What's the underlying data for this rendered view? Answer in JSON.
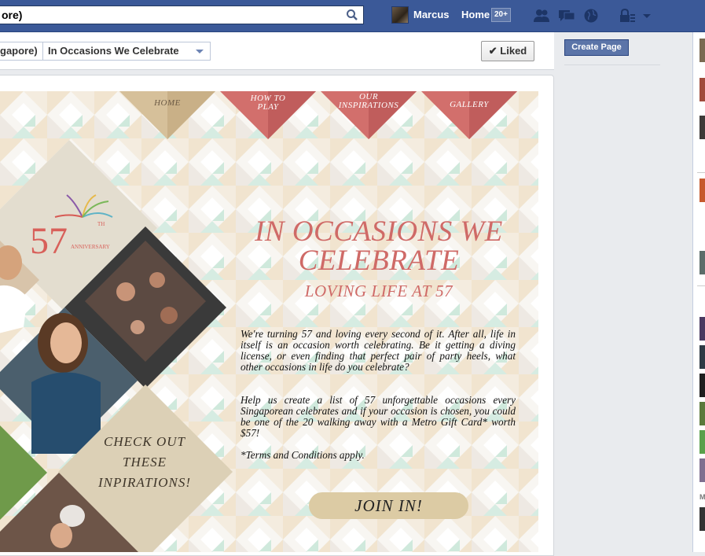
{
  "topbar": {
    "search_value": "ore)",
    "user_name": "Marcus",
    "home_label": "Home",
    "home_badge": "20+",
    "icons": [
      "search-icon",
      "friend-requests-icon",
      "messages-icon",
      "notifications-globe-icon",
      "privacy-lock-icon",
      "account-menu-chevron-icon"
    ]
  },
  "header": {
    "crumb_prev": "gapore)",
    "crumb_page": "In Occasions We Celebrate",
    "liked_label": "Liked"
  },
  "app": {
    "nav": [
      "HOME",
      "HOW TO PLAY",
      "OUR INSPIRATIONS",
      "GALLERY"
    ],
    "badge_number": "57",
    "badge_super": "TH",
    "badge_word": "ANNIVERSARY",
    "title": "IN OCCASIONS WE CELEBRATE",
    "subtitle": "LOVING LIFE AT 57",
    "para1": "We're turning 57 and loving every second of it. After all, life in itself is an occasion worth celebrating. Be it getting a diving license, or even finding that perfect pair of party heels, what other occasions in life do you celebrate?",
    "para2": "Help us create a list of 57 unforgettable occasions every Singaporean celebrates and if your occasion is chosen, you could be one of the 20 walking away with a Metro Gift Card* worth $57!",
    "para3": "*Terms and Conditions apply.",
    "join_label": "JOIN IN!",
    "checkout": "CHECK OUT THESE INPIRATIONS!"
  },
  "sidebar": {
    "create_page_label": "Create Page"
  },
  "chat": {
    "section_letter": "M"
  },
  "colors": {
    "facebook_blue": "#3b5998",
    "accent_red": "#cf6a67",
    "nav_tan": "#d6c09a",
    "join_tan": "#dccba4"
  }
}
